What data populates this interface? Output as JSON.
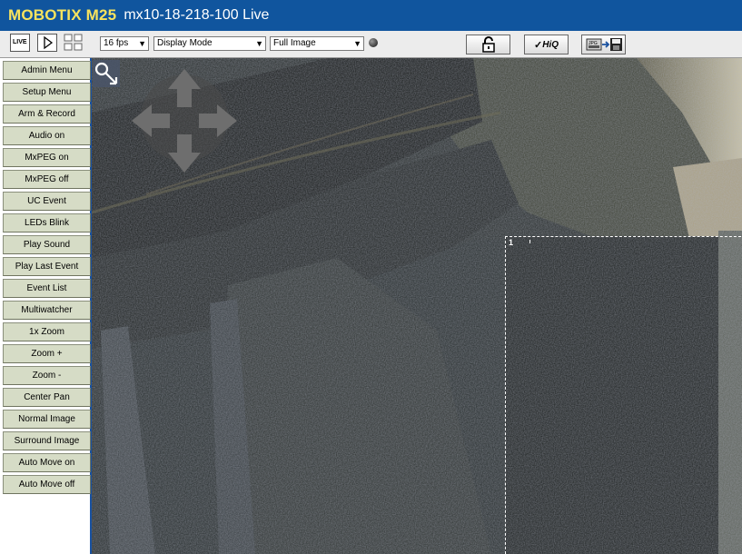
{
  "header": {
    "brand": "MOBOTIX M25",
    "title": "mx10-18-218-100 Live"
  },
  "toolbar": {
    "live_label": "LIVE",
    "fps": "16 fps",
    "display_mode": "Display Mode",
    "image_mode": "Full Image",
    "hiq_label": "HiQ",
    "jpg_label": "JPG"
  },
  "sidebar": {
    "items": [
      {
        "label": "Admin Menu"
      },
      {
        "label": "Setup Menu"
      },
      {
        "label": "Arm & Record"
      },
      {
        "label": "Audio on"
      },
      {
        "label": "MxPEG on"
      },
      {
        "label": "MxPEG off"
      },
      {
        "label": "UC Event"
      },
      {
        "label": "LEDs Blink"
      },
      {
        "label": "Play Sound"
      },
      {
        "label": "Play Last Event"
      },
      {
        "label": "Event List"
      },
      {
        "label": "Multiwatcher"
      },
      {
        "label": "1x Zoom"
      },
      {
        "label": "Zoom +"
      },
      {
        "label": "Zoom -"
      },
      {
        "label": "Center Pan"
      },
      {
        "label": "Normal Image"
      },
      {
        "label": "Surround Image"
      },
      {
        "label": "Auto Move on"
      },
      {
        "label": "Auto Move off"
      }
    ]
  },
  "video": {
    "region_number": "1"
  },
  "colors": {
    "title_bar": "#10559e",
    "brand_text": "#f7e35e",
    "sidebar_button": "#d6dcc6",
    "sidebar_border": "#1a52a0"
  }
}
